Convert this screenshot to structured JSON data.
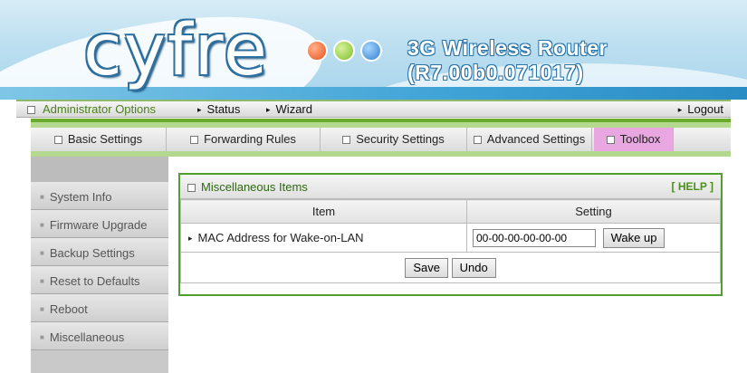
{
  "header": {
    "logo_text": "cyfre",
    "product_title": "3G Wireless Router (R7.00b0.071017)"
  },
  "topmenu": {
    "admin_label": "Administrator Options",
    "status_label": "Status",
    "wizard_label": "Wizard",
    "logout_label": "Logout"
  },
  "tabs": [
    {
      "label": "Basic Settings"
    },
    {
      "label": "Forwarding Rules"
    },
    {
      "label": "Security Settings"
    },
    {
      "label": "Advanced Settings"
    },
    {
      "label": "Toolbox",
      "active": true
    }
  ],
  "sidebar": {
    "items": [
      {
        "label": "System Info"
      },
      {
        "label": "Firmware Upgrade"
      },
      {
        "label": "Backup Settings"
      },
      {
        "label": "Reset to Defaults"
      },
      {
        "label": "Reboot"
      },
      {
        "label": "Miscellaneous"
      }
    ]
  },
  "panel": {
    "title": "Miscellaneous Items",
    "help_label": "[ HELP ]",
    "columns": [
      "Item",
      "Setting"
    ],
    "row": {
      "item_label": "MAC Address for Wake-on-LAN",
      "mac_value": "00-00-00-00-00-00",
      "wake_label": "Wake up"
    },
    "save_label": "Save",
    "undo_label": "Undo"
  },
  "colors": {
    "accent_green": "#4fa02e",
    "active_tab": "#e8a7e0",
    "banner_blue": "#3fa3d6"
  }
}
